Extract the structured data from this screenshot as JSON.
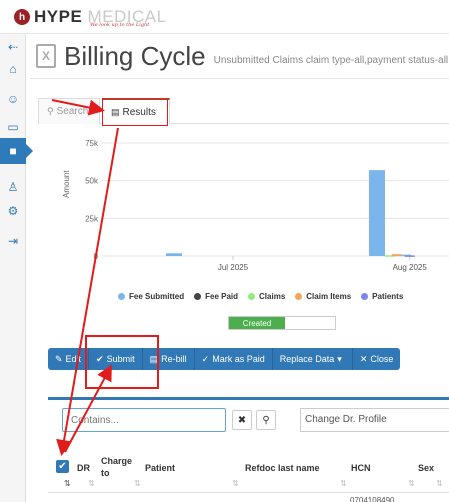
{
  "brand": {
    "name_1": "HYPE",
    "name_2": "MEDICAL",
    "logo_mark": "h",
    "tagline": "We look up to the Light",
    "color": "#9b2124"
  },
  "sidebar": {
    "items": [
      {
        "icon": "collapse-arrow-icon",
        "glyph": "⇠"
      },
      {
        "icon": "home-settings-icon",
        "glyph": "⌂"
      },
      {
        "icon": "users-icon",
        "glyph": "☺"
      },
      {
        "icon": "book-icon",
        "glyph": "▭"
      },
      {
        "icon": "briefcase-icon",
        "glyph": "■",
        "active": true
      },
      {
        "icon": "user-group-icon",
        "glyph": "♙"
      },
      {
        "icon": "gear-icon",
        "glyph": "⚙"
      },
      {
        "icon": "sign-out-icon",
        "glyph": "⇥"
      }
    ],
    "accent": "#2f7ab8"
  },
  "header": {
    "title": "Billing Cycle",
    "subtitle": "Unsubmitted Claims claim type-all,payment status-all",
    "icon": "excel-icon"
  },
  "tabs": [
    {
      "label": "Search",
      "icon": "search-icon",
      "active": false
    },
    {
      "label": "Results",
      "icon": "document-icon",
      "active": true
    }
  ],
  "chart_data": {
    "type": "bar",
    "ylabel": "Amount",
    "yticks": [
      "75k",
      "50k",
      "25k",
      "0"
    ],
    "ylim": [
      0,
      75000
    ],
    "xticks": [
      "Jul 2025",
      "Aug 2025"
    ],
    "series": [
      {
        "name": "Fee Submitted",
        "color": "#7cb5ec",
        "points": [
          {
            "x": "2025-07-01",
            "y": 1800
          },
          {
            "x": "2025-08-01",
            "y": 57000
          },
          {
            "x": "2025-08-05",
            "y": 900
          }
        ]
      },
      {
        "name": "Fee Paid",
        "color": "#434348",
        "points": []
      },
      {
        "name": "Claims",
        "color": "#90ed7d",
        "points": [
          {
            "x": "2025-08-03",
            "y": 500
          }
        ]
      },
      {
        "name": "Claim Items",
        "color": "#f7a35c",
        "points": [
          {
            "x": "2025-08-04",
            "y": 1200
          }
        ]
      },
      {
        "name": "Patients",
        "color": "#8085e9",
        "points": [
          {
            "x": "2025-08-06",
            "y": 400
          }
        ]
      }
    ],
    "legend_position": "bottom"
  },
  "toggle": {
    "label": "Created",
    "color": "#4cae4c"
  },
  "toolbar": {
    "buttons": [
      {
        "label": "Edit",
        "icon": "edit-icon",
        "glyph": "✎"
      },
      {
        "label": "Submit",
        "icon": "check-icon",
        "glyph": "✔"
      },
      {
        "label": "Re-bill",
        "icon": "file-icon",
        "glyph": "▤"
      },
      {
        "label": "Mark as Paid",
        "icon": "check-circle-icon",
        "glyph": "✓"
      },
      {
        "label": "Replace Data",
        "icon": "caret-down-icon",
        "glyph": "▾"
      },
      {
        "label": "Close",
        "icon": "close-circle-icon",
        "glyph": "✕"
      }
    ],
    "color": "#3178b7"
  },
  "filter": {
    "placeholder": "Contains...",
    "clear_glyph": "✖",
    "search_glyph": "⚲",
    "profile": "Change Dr. Profile"
  },
  "table": {
    "columns": [
      "DR",
      "Charge to",
      "Patient",
      "Refdoc last name",
      "HCN",
      "Sex"
    ],
    "sort_glyph": "⇅",
    "first_cell_peek": "0704108490"
  },
  "annotation_color": "#e21b1b"
}
